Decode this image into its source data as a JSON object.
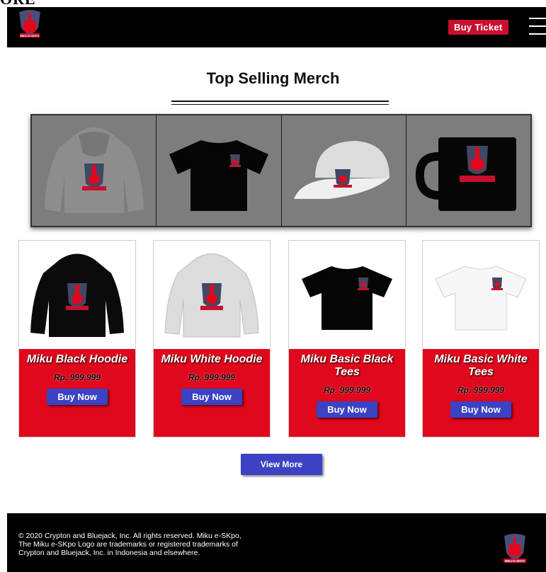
{
  "top_fragment": "ORE",
  "navbar": {
    "logo_text": "MIKU E-SKPO",
    "buy_ticket_label": "Buy Ticket"
  },
  "section": {
    "title": "Top Selling Merch"
  },
  "carousel": {
    "slides": [
      {
        "item": "hoodie",
        "logo_text": "MIKU E-SKPO"
      },
      {
        "item": "tee",
        "logo_text": "MIKU E-SKPO"
      },
      {
        "item": "cap",
        "logo_text": "MIKU E-SKPO"
      },
      {
        "item": "mug",
        "logo_text": "MIKU E-SKPO"
      }
    ]
  },
  "products": [
    {
      "name": "Miku Black Hoodie",
      "price": "Rp. 999.999",
      "button": "Buy Now",
      "logo_text": "MIKU E-SKPO"
    },
    {
      "name": "Miku White Hoodie",
      "price": "Rp. 999.999",
      "button": "Buy Now",
      "logo_text": "MIKU E-SKPO"
    },
    {
      "name": "Miku Basic Black Tees",
      "price": "Rp. 999.999",
      "button": "Buy Now",
      "logo_text": "MIKU E-SKPO"
    },
    {
      "name": "Miku Basic White Tees",
      "price": "Rp. 999.999",
      "button": "Buy Now",
      "logo_text": "MIKU E-SKPO"
    }
  ],
  "view_more_label": "View More",
  "footer": {
    "text": "© 2020 Crypton and Bluejack, Inc. All rights reserved. Miku e-SKpo, The Miku e-SKpo Logo are trademarks or registered trademarks of Crypton and Bluejack, Inc. in Indonesia and elsewhere.",
    "logo_text": "MIKU E-SKPO"
  },
  "colors": {
    "navbar_bg": "#000000",
    "accent_red": "#e0081d",
    "button_blue": "#3b42c4",
    "logo_purple": "#4a4f7a"
  }
}
